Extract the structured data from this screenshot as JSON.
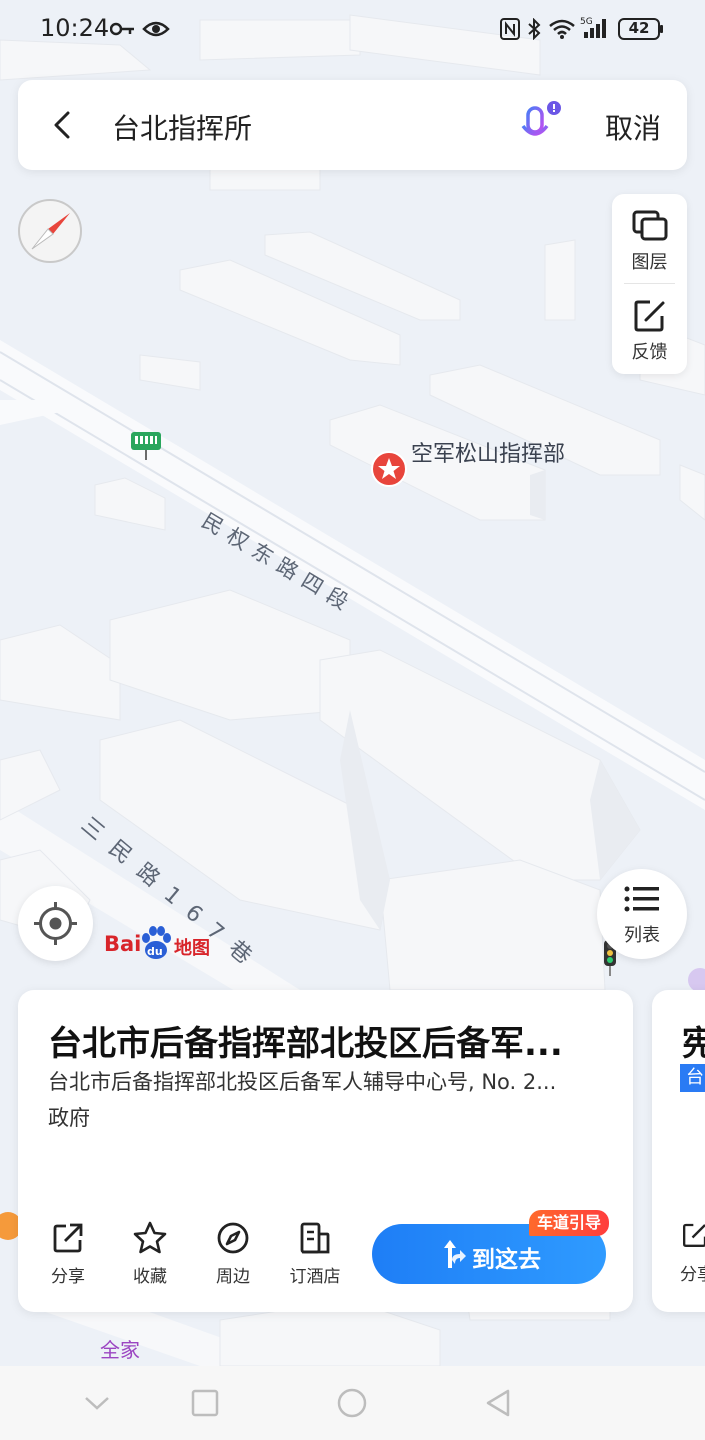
{
  "status_bar": {
    "time": "10:24",
    "battery": "42"
  },
  "search": {
    "query": "台北指挥所",
    "cancel_label": "取消"
  },
  "right_panel": {
    "layers_label": "图层",
    "feedback_label": "反馈"
  },
  "map": {
    "poi": {
      "name": "空军松山指挥部"
    },
    "roads": [
      {
        "name": "民权东路四段"
      },
      {
        "name": "三民路167巷"
      }
    ],
    "shop_label": "全家"
  },
  "list_button": {
    "label": "列表"
  },
  "logo": {
    "left": "Bai",
    "middle": "du",
    "right": "地图"
  },
  "card": {
    "title": "台北市后备指挥部北投区后备军...",
    "address": "台北市后备指挥部北投区后备军人辅导中心号, No. 2...",
    "category": "政府",
    "actions": [
      {
        "label": "分享",
        "icon": "share-icon"
      },
      {
        "label": "收藏",
        "icon": "star-icon"
      },
      {
        "label": "周边",
        "icon": "compass-icon"
      },
      {
        "label": "订酒店",
        "icon": "hotel-icon"
      }
    ],
    "go_label": "到这去",
    "lane_badge": "车道引导"
  },
  "card2": {
    "title": "宪",
    "tag": "台",
    "share_label": "分享"
  },
  "colors": {
    "accent": "#1e7ef6",
    "poi_red": "#e8453c",
    "badge": "#ff4d2e"
  }
}
